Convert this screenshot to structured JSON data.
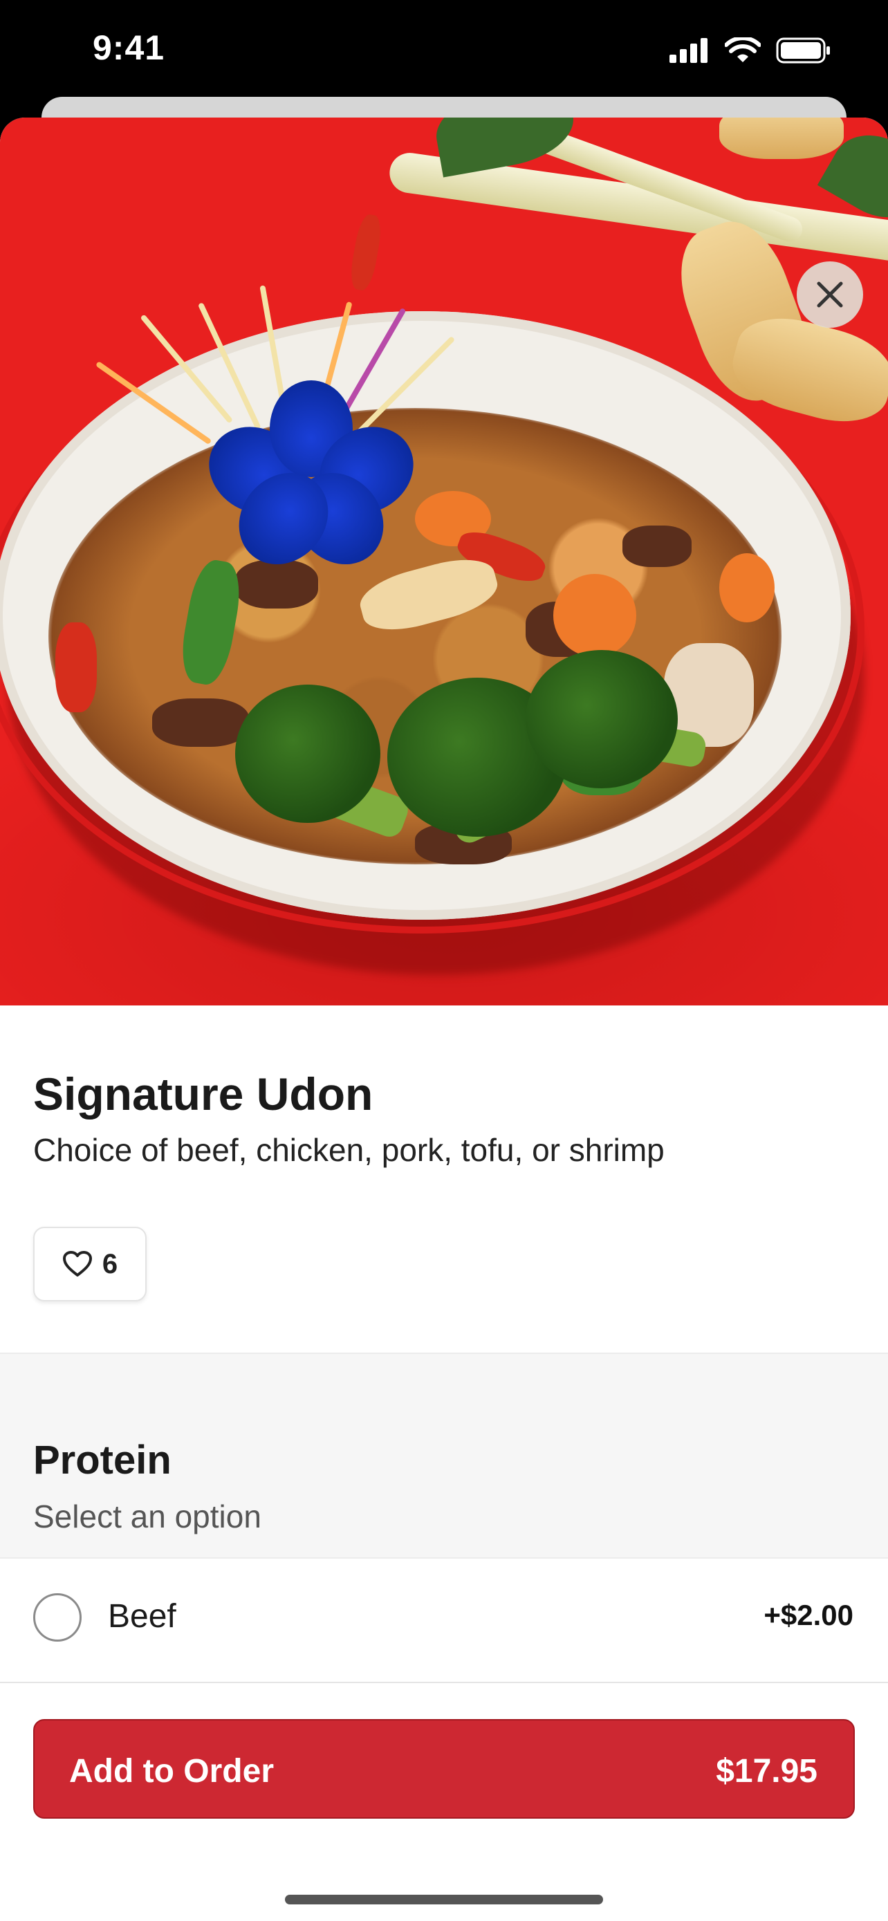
{
  "status_bar": {
    "time": "9:41",
    "icons": [
      "signal-icon",
      "wifi-icon",
      "battery-icon"
    ]
  },
  "item": {
    "image": "food-photo-signature-udon",
    "title": "Signature Udon",
    "description": "Choice of beef, chicken, pork, tofu, or shrimp",
    "likes": "6"
  },
  "close": {
    "icon": "close-icon"
  },
  "option_group": {
    "title": "Protein",
    "subtitle": "Select an option",
    "options": [
      {
        "label": "Beef",
        "price": "+$2.00",
        "selected": false
      }
    ]
  },
  "cart": {
    "label": "Add to Order",
    "price": "$17.95"
  },
  "colors": {
    "accent": "#cd2832",
    "hero_background": "#e8201f",
    "group_background": "#f6f6f6"
  }
}
